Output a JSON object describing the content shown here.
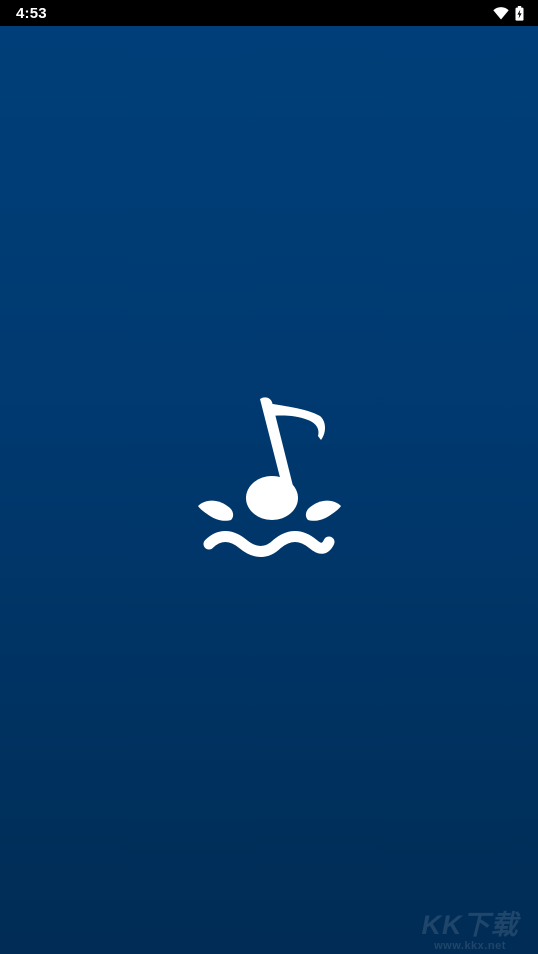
{
  "status_bar": {
    "time": "4:53",
    "icons": [
      "wifi-icon",
      "battery-icon"
    ]
  },
  "splash": {
    "logo_icon": "music-note-waves-icon",
    "colors": {
      "background_top": "#003f7a",
      "background_bottom": "#002c55",
      "logo": "#ffffff"
    }
  },
  "watermark": {
    "brand": "KK下载",
    "url": "www.kkx.net"
  }
}
